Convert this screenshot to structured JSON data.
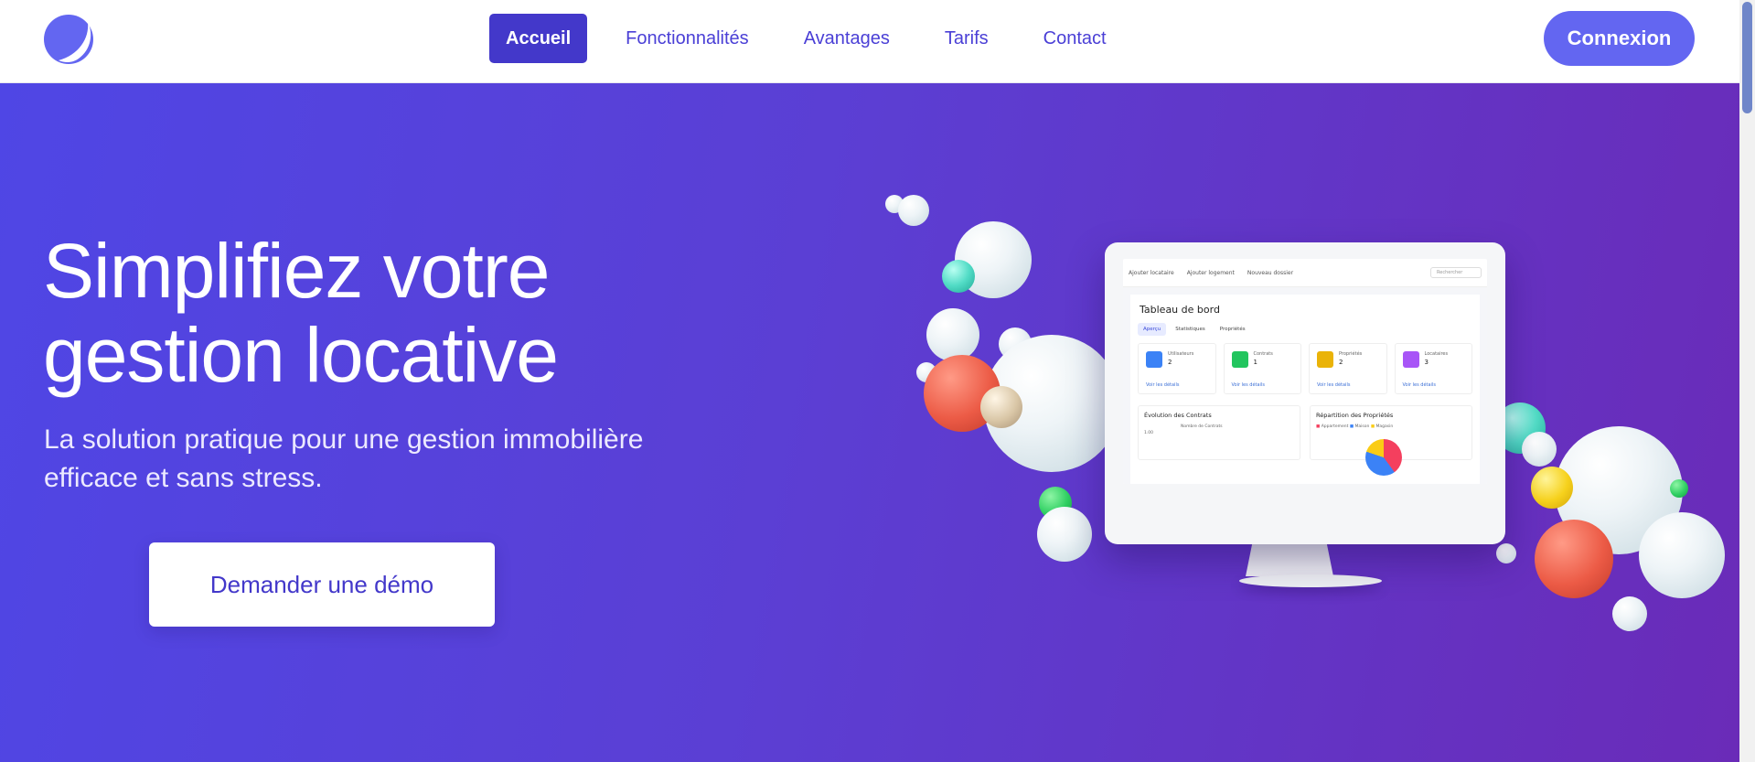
{
  "header": {
    "logo_icon": "crescent-moon-logo-icon",
    "nav": [
      {
        "label": "Accueil",
        "active": true
      },
      {
        "label": "Fonctionnalités",
        "active": false
      },
      {
        "label": "Avantages",
        "active": false
      },
      {
        "label": "Tarifs",
        "active": false
      },
      {
        "label": "Contact",
        "active": false
      }
    ],
    "login_label": "Connexion"
  },
  "hero": {
    "title_line1": "Simplifiez votre",
    "title_line2": "gestion locative",
    "subtitle_line1": "La solution pratique pour une gestion immobilière",
    "subtitle_line2": "efficace et sans stress.",
    "cta_label": "Demander une démo"
  },
  "mockup": {
    "topbar": {
      "add_tenant": "Ajouter locataire",
      "add_housing": "Ajouter logement",
      "new_file": "Nouveau dossier",
      "search_placeholder": "Rechercher"
    },
    "title": "Tableau de bord",
    "tabs": [
      "Aperçu",
      "Statistiques",
      "Propriétés"
    ],
    "cards": [
      {
        "label": "Utilisateurs",
        "value": "2",
        "link": "Voir les détails",
        "color": "#3b82f6"
      },
      {
        "label": "Contrats",
        "value": "1",
        "link": "Voir les détails",
        "color": "#22c55e"
      },
      {
        "label": "Propriétés",
        "value": "2",
        "link": "Voir les détails",
        "color": "#eab308"
      },
      {
        "label": "Locataires",
        "value": "3",
        "link": "Voir les détails",
        "color": "#a855f7"
      }
    ],
    "chart1": {
      "title": "Évolution des Contrats",
      "legend": "Nombre de Contrats",
      "ytick": "1.00"
    },
    "chart2": {
      "title": "Répartition des Propriétés",
      "legend": [
        "Appartement",
        "Maison",
        "Magasin"
      ]
    }
  },
  "colors": {
    "primary": "#4338ca",
    "accent": "#6366f1",
    "hero_start": "#4f46e5",
    "hero_end": "#6a2bb8"
  }
}
